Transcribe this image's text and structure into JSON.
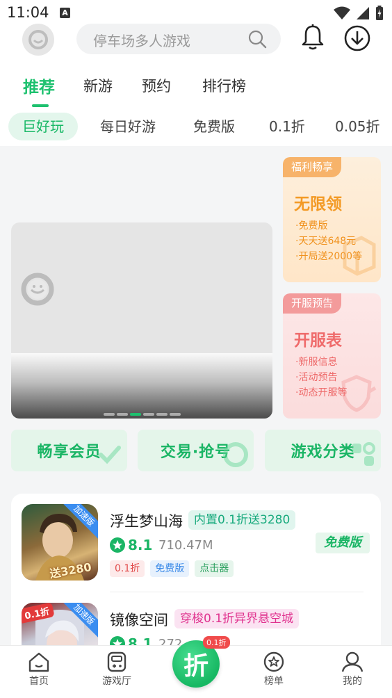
{
  "status_bar": {
    "time": "11:04",
    "notification_letter": "A"
  },
  "search": {
    "placeholder": "停车场多人游戏"
  },
  "tabs": [
    {
      "label": "推荐",
      "active": true
    },
    {
      "label": "新游"
    },
    {
      "label": "预约"
    },
    {
      "label": "排行榜"
    }
  ],
  "subtabs": [
    {
      "label": "巨好玩",
      "active": true
    },
    {
      "label": "每日好游"
    },
    {
      "label": "免费版"
    },
    {
      "label": "0.1折"
    },
    {
      "label": "0.05折"
    }
  ],
  "banner": {
    "dot_count": 6,
    "active_dot": 2
  },
  "welfare_card": {
    "tag": "福利畅享",
    "title": "无限领",
    "lines": [
      "·免费版",
      "·天天送648元",
      "·开局送2000等"
    ]
  },
  "server_card": {
    "tag": "开服预告",
    "title": "开服表",
    "lines": [
      "·新服信息",
      "·活动预告",
      "·动态开服等"
    ]
  },
  "quick_links": [
    "畅享会员",
    "交易·抢号",
    "游戏分类"
  ],
  "games": [
    {
      "name": "浮生梦山海",
      "promo": "内置0.1折送3280",
      "rating": "8.1",
      "size": "710.47M",
      "ribbon": "加速版",
      "icon_text": "送3280",
      "tags": [
        "0.1折",
        "免费版",
        "点击器"
      ],
      "badge": "免费版"
    },
    {
      "name": "镜像空间",
      "promo": "穿梭0.1折异界悬空城",
      "rating": "8.1",
      "size": "272",
      "ribbon": "加速版",
      "discount": "0.1折"
    }
  ],
  "bottom_nav": {
    "home": "首页",
    "game_hall": "游戏厅",
    "center_char": "折",
    "center_badge": "0.1折",
    "ranking": "榜单",
    "mine": "我的"
  },
  "colors": {
    "accent": "#1ec16f",
    "welfare_orange": "#f39a25",
    "server_pink": "#ef6b6b"
  }
}
